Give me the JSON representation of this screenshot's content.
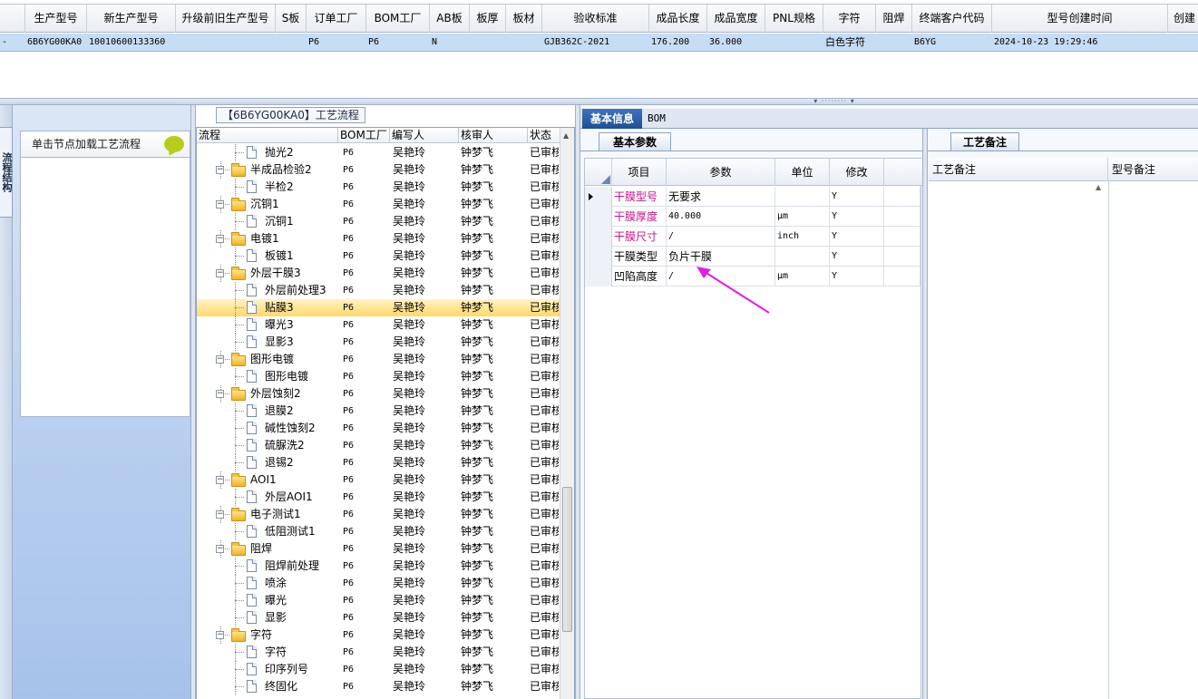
{
  "top_grid": {
    "columns": [
      "生产型号",
      "新生产型号",
      "升级前旧生产型号",
      "S板",
      "订单工厂",
      "BOM工厂",
      "AB板",
      "板厚",
      "板材",
      "验收标准",
      "成品长度",
      "成品宽度",
      "PNL规格",
      "字符",
      "阻焊",
      "终端客户代码",
      "型号创建时间",
      "创建"
    ],
    "row": {
      "model": "6B6YG00KA0",
      "new_model": "10010600133360",
      "old_model": "",
      "s_board": "",
      "order_factory": "P6",
      "bom_factory": "P6",
      "ab_board": "N",
      "thickness": "",
      "material": "",
      "standard": "GJB362C-2021",
      "length": "176.200",
      "width": "36.000",
      "pnl": "",
      "char": "白色字符",
      "solder": "",
      "customer": "B6YG",
      "created": "2024-10-23 19:29:46"
    }
  },
  "left_strip": {
    "tab_label": "流程结构"
  },
  "left_panel": {
    "header_text": "单击节点加载工艺流程"
  },
  "tree": {
    "title": "【6B6YG00KA0】工艺流程",
    "columns": [
      "流程",
      "BOM工厂",
      "编写人",
      "核审人",
      "状态"
    ],
    "rows": [
      {
        "level": 2,
        "name": "抛光2",
        "bom": "P6",
        "writer": "吴艳玲",
        "reviewer": "钟梦飞",
        "status": "已审核"
      },
      {
        "level": 1,
        "name": "半成品检验2",
        "bom": "P6",
        "writer": "吴艳玲",
        "reviewer": "钟梦飞",
        "status": "已审核"
      },
      {
        "level": 2,
        "name": "半检2",
        "bom": "P6",
        "writer": "吴艳玲",
        "reviewer": "钟梦飞",
        "status": "已审核"
      },
      {
        "level": 1,
        "name": "沉铜1",
        "bom": "P6",
        "writer": "吴艳玲",
        "reviewer": "钟梦飞",
        "status": "已审核"
      },
      {
        "level": 2,
        "name": "沉铜1",
        "bom": "P6",
        "writer": "吴艳玲",
        "reviewer": "钟梦飞",
        "status": "已审核"
      },
      {
        "level": 1,
        "name": "电镀1",
        "bom": "P6",
        "writer": "吴艳玲",
        "reviewer": "钟梦飞",
        "status": "已审核"
      },
      {
        "level": 2,
        "name": "板镀1",
        "bom": "P6",
        "writer": "吴艳玲",
        "reviewer": "钟梦飞",
        "status": "已审核"
      },
      {
        "level": 1,
        "name": "外层干膜3",
        "bom": "P6",
        "writer": "吴艳玲",
        "reviewer": "钟梦飞",
        "status": "已审核"
      },
      {
        "level": 2,
        "name": "外层前处理3",
        "bom": "P6",
        "writer": "吴艳玲",
        "reviewer": "钟梦飞",
        "status": "已审核"
      },
      {
        "level": 2,
        "name": "贴膜3",
        "bom": "P6",
        "writer": "吴艳玲",
        "reviewer": "钟梦飞",
        "status": "已审核",
        "selected": true
      },
      {
        "level": 2,
        "name": "曝光3",
        "bom": "P6",
        "writer": "吴艳玲",
        "reviewer": "钟梦飞",
        "status": "已审核"
      },
      {
        "level": 2,
        "name": "显影3",
        "bom": "P6",
        "writer": "吴艳玲",
        "reviewer": "钟梦飞",
        "status": "已审核"
      },
      {
        "level": 1,
        "name": "图形电镀",
        "bom": "P6",
        "writer": "吴艳玲",
        "reviewer": "钟梦飞",
        "status": "已审核"
      },
      {
        "level": 2,
        "name": "图形电镀",
        "bom": "P6",
        "writer": "吴艳玲",
        "reviewer": "钟梦飞",
        "status": "已审核"
      },
      {
        "level": 1,
        "name": "外层蚀刻2",
        "bom": "P6",
        "writer": "吴艳玲",
        "reviewer": "钟梦飞",
        "status": "已审核"
      },
      {
        "level": 2,
        "name": "退膜2",
        "bom": "P6",
        "writer": "吴艳玲",
        "reviewer": "钟梦飞",
        "status": "已审核"
      },
      {
        "level": 2,
        "name": "碱性蚀刻2",
        "bom": "P6",
        "writer": "吴艳玲",
        "reviewer": "钟梦飞",
        "status": "已审核"
      },
      {
        "level": 2,
        "name": "硫脲洗2",
        "bom": "P6",
        "writer": "吴艳玲",
        "reviewer": "钟梦飞",
        "status": "已审核"
      },
      {
        "level": 2,
        "name": "退锡2",
        "bom": "P6",
        "writer": "吴艳玲",
        "reviewer": "钟梦飞",
        "status": "已审核"
      },
      {
        "level": 1,
        "name": "AOI1",
        "bom": "P6",
        "writer": "吴艳玲",
        "reviewer": "钟梦飞",
        "status": "已审核"
      },
      {
        "level": 2,
        "name": "外层AOI1",
        "bom": "P6",
        "writer": "吴艳玲",
        "reviewer": "钟梦飞",
        "status": "已审核"
      },
      {
        "level": 1,
        "name": "电子测试1",
        "bom": "P6",
        "writer": "吴艳玲",
        "reviewer": "钟梦飞",
        "status": "已审核"
      },
      {
        "level": 2,
        "name": "低阻测试1",
        "bom": "P6",
        "writer": "吴艳玲",
        "reviewer": "钟梦飞",
        "status": "已审核"
      },
      {
        "level": 1,
        "name": "阻焊",
        "bom": "P6",
        "writer": "吴艳玲",
        "reviewer": "钟梦飞",
        "status": "已审核"
      },
      {
        "level": 2,
        "name": "阻焊前处理",
        "bom": "P6",
        "writer": "吴艳玲",
        "reviewer": "钟梦飞",
        "status": "已审核"
      },
      {
        "level": 2,
        "name": "喷涂",
        "bom": "P6",
        "writer": "吴艳玲",
        "reviewer": "钟梦飞",
        "status": "已审核"
      },
      {
        "level": 2,
        "name": "曝光",
        "bom": "P6",
        "writer": "吴艳玲",
        "reviewer": "钟梦飞",
        "status": "已审核"
      },
      {
        "level": 2,
        "name": "显影",
        "bom": "P6",
        "writer": "吴艳玲",
        "reviewer": "钟梦飞",
        "status": "已审核"
      },
      {
        "level": 1,
        "name": "字符",
        "bom": "P6",
        "writer": "吴艳玲",
        "reviewer": "钟梦飞",
        "status": "已审核"
      },
      {
        "level": 2,
        "name": "字符",
        "bom": "P6",
        "writer": "吴艳玲",
        "reviewer": "钟梦飞",
        "status": "已审核"
      },
      {
        "level": 2,
        "name": "印序列号",
        "bom": "P6",
        "writer": "吴艳玲",
        "reviewer": "钟梦飞",
        "status": "已审核"
      },
      {
        "level": 2,
        "name": "终固化",
        "bom": "P6",
        "writer": "吴艳玲",
        "reviewer": "钟梦飞",
        "status": "已审核"
      }
    ]
  },
  "right": {
    "tabs": [
      "基本信息",
      "BOM"
    ],
    "sub_tab": "基本参数",
    "notes_tab": "工艺备注",
    "param_columns": [
      "项目",
      "参数",
      "单位",
      "修改"
    ],
    "params": [
      {
        "item": "干膜型号",
        "value": "无要求",
        "unit": "",
        "edit": "Y",
        "highlight": true
      },
      {
        "item": "干膜厚度",
        "value": "40.000",
        "unit": "μm",
        "edit": "Y",
        "highlight": true
      },
      {
        "item": "干膜尺寸",
        "value": "/",
        "unit": "inch",
        "edit": "Y",
        "highlight": true
      },
      {
        "item": "干膜类型",
        "value": "负片干膜",
        "unit": "",
        "edit": "Y",
        "highlight": false
      },
      {
        "item": "凹陷高度",
        "value": "/",
        "unit": "μm",
        "edit": "Y",
        "highlight": false
      }
    ],
    "notes_columns": [
      "工艺备注",
      "型号备注"
    ]
  },
  "colors": {
    "accent_tab": "#1e4f94",
    "selected_row": "#ffd86b",
    "highlight_text": "#c0158a",
    "annotation_arrow": "#e020e0"
  }
}
